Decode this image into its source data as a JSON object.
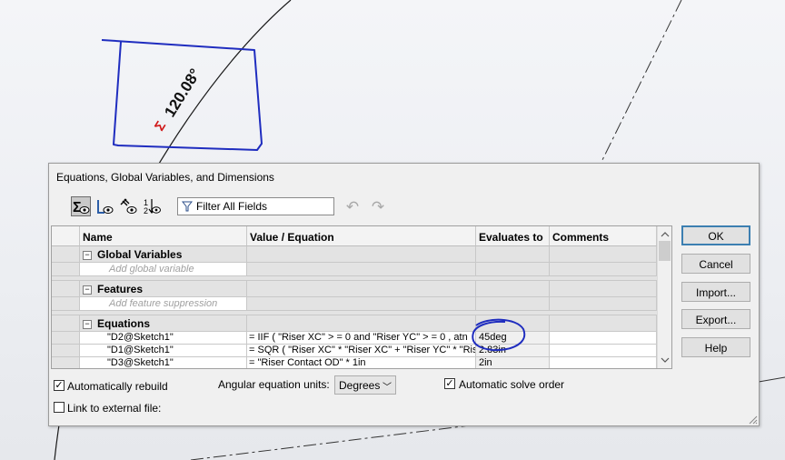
{
  "sketch": {
    "dimension_text": "120.08°"
  },
  "dialog": {
    "title": "Equations, Global Variables, and Dimensions",
    "toolbar": {
      "filter_placeholder": "Filter All Fields",
      "view_icons": [
        "equation-view-icon",
        "sketch-equation-view-icon",
        "dimension-view-icon",
        "ordered-view-icon"
      ]
    },
    "grid": {
      "columns": [
        "Name",
        "Value / Equation",
        "Evaluates to",
        "Comments"
      ],
      "sections": [
        {
          "label": "Global Variables",
          "placeholder": "Add global variable"
        },
        {
          "label": "Features",
          "placeholder": "Add feature suppression"
        },
        {
          "label": "Equations"
        }
      ],
      "rows": [
        {
          "name": "\"D2@Sketch1\"",
          "equation": "= IIF ( \"Riser XC\" > = 0 and \"Riser YC\" > = 0 , atn",
          "result": "45deg"
        },
        {
          "name": "\"D1@Sketch1\"",
          "equation": "= SQR ( \"Riser XC\" * \"Riser XC\" + \"Riser YC\" * \"Riser",
          "result": "2.83in"
        },
        {
          "name": "\"D3@Sketch1\"",
          "equation": "= \"Riser Contact OD\" * 1in",
          "result": "2in"
        }
      ]
    },
    "options": {
      "auto_rebuild": {
        "label": "Automatically rebuild",
        "checked": true
      },
      "angular_units_label": "Angular equation units:",
      "angular_units_value": "Degrees",
      "auto_solve": {
        "label": "Automatic solve order",
        "checked": true
      },
      "link_external": {
        "label": "Link to external file:",
        "checked": false
      }
    },
    "buttons": {
      "ok": "OK",
      "cancel": "Cancel",
      "import": "Import...",
      "export": "Export...",
      "help": "Help"
    }
  }
}
